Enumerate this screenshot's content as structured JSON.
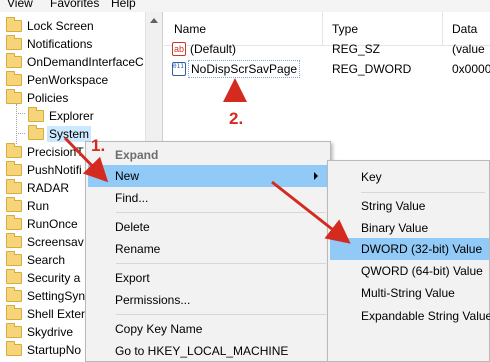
{
  "menubar": {
    "view": "View",
    "favorites": "Favorites",
    "help": "Help"
  },
  "tree": {
    "items": [
      {
        "label": "Lock Screen"
      },
      {
        "label": "Notifications"
      },
      {
        "label": "OnDemandInterfaceC"
      },
      {
        "label": "PenWorkspace"
      },
      {
        "label": "Policies"
      },
      {
        "label": "Explorer"
      },
      {
        "label": "System"
      },
      {
        "label": "PrecisionT"
      },
      {
        "label": "PushNotifi"
      },
      {
        "label": "RADAR"
      },
      {
        "label": "Run"
      },
      {
        "label": "RunOnce"
      },
      {
        "label": "Screensav"
      },
      {
        "label": "Search"
      },
      {
        "label": "Security a"
      },
      {
        "label": "SettingSyn"
      },
      {
        "label": "Shell Exter"
      },
      {
        "label": "Skydrive"
      },
      {
        "label": "StartupNo"
      }
    ]
  },
  "list": {
    "headers": {
      "name": "Name",
      "type": "Type",
      "data": "Data"
    },
    "rows": [
      {
        "icon": "string-value-icon",
        "icon_text": "ab",
        "name": "(Default)",
        "type": "REG_SZ",
        "data": "(value"
      },
      {
        "icon": "binary-value-icon",
        "icon_text": "011 110",
        "name": "NoDispScrSavPage",
        "type": "REG_DWORD",
        "data": "0x0000"
      }
    ]
  },
  "context_menu": {
    "expand": "Expand",
    "new": "New",
    "find": "Find...",
    "delete": "Delete",
    "rename": "Rename",
    "export": "Export",
    "permissions": "Permissions...",
    "copy_key_name": "Copy Key Name",
    "goto": "Go to HKEY_LOCAL_MACHINE"
  },
  "submenu": {
    "key": "Key",
    "string_value": "String Value",
    "binary_value": "Binary Value",
    "dword_value": "DWORD (32-bit) Value",
    "qword_value": "QWORD (64-bit) Value",
    "multi_string_value": "Multi-String Value",
    "expandable_string_value": "Expandable String Value"
  },
  "annotations": {
    "step1": "1.",
    "step2": "2."
  },
  "colors": {
    "highlight": "#91c9f7",
    "annotation": "#d42a20",
    "folder": "#f6d57a"
  }
}
